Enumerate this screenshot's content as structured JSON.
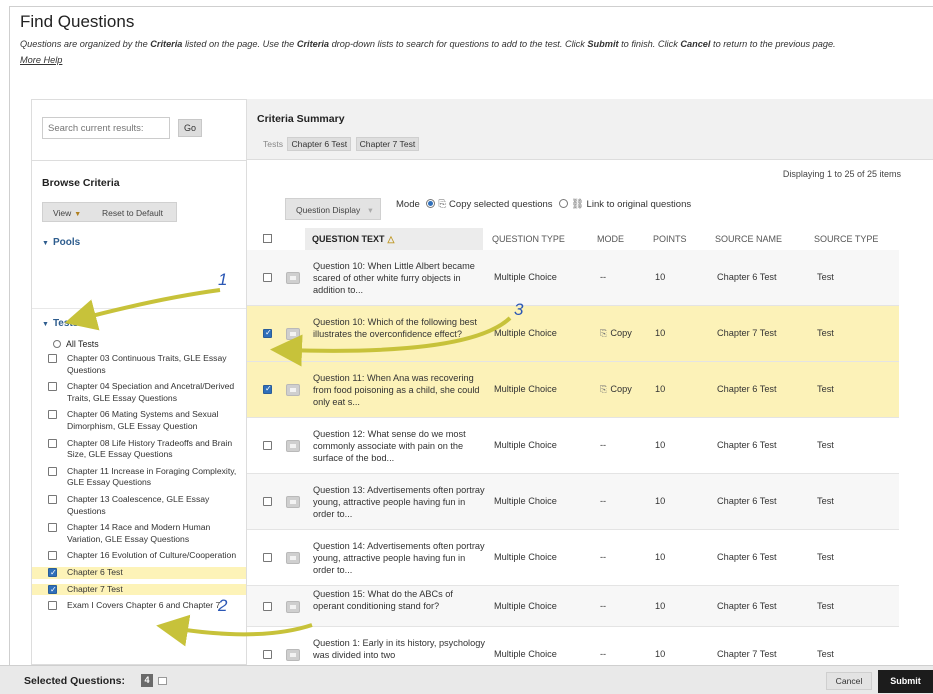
{
  "page": {
    "title": "Find Questions",
    "desc": {
      "p1": "Questions are organized by the ",
      "b1": "Criteria",
      "p2": " listed on the page. Use the ",
      "b2": "Criteria",
      "p3": " drop-down lists to search for questions to add to the test. Click ",
      "b3": "Submit",
      "p4": " to finish. Click ",
      "b4": "Cancel",
      "p5": " to return to the previous page."
    },
    "more_help": "More Help"
  },
  "left": {
    "search_placeholder": "Search current results:",
    "go_label": "Go",
    "browse_title": "Browse Criteria",
    "view_label": "View",
    "reset_label": "Reset to Default",
    "pools_label": "Pools",
    "tests_label": "Tests",
    "all_tests_label": "All Tests",
    "tests": [
      {
        "label": "Chapter 03 Continuous Traits, GLE Essay Questions",
        "checked": false
      },
      {
        "label": "Chapter 04 Speciation and Ancetral/Derived Traits, GLE Essay Questions",
        "checked": false
      },
      {
        "label": "Chapter 06 Mating Systems and Sexual Dimorphism, GLE Essay Question",
        "checked": false
      },
      {
        "label": "Chapter 08 Life History Tradeoffs and Brain Size, GLE Essay Questions",
        "checked": false
      },
      {
        "label": "Chapter 11 Increase in Foraging Complexity, GLE Essay Questions",
        "checked": false
      },
      {
        "label": "Chapter 13 Coalescence, GLE Essay Questions",
        "checked": false
      },
      {
        "label": "Chapter 14 Race and Modern Human Variation, GLE Essay Questions",
        "checked": false
      },
      {
        "label": "Chapter 16 Evolution of Culture/Cooperation",
        "checked": false
      },
      {
        "label": "Chapter 6 Test",
        "checked": true
      },
      {
        "label": "Chapter 7 Test",
        "checked": true
      },
      {
        "label": "Exam I Covers Chapter 6 and Chapter 7",
        "checked": false
      }
    ]
  },
  "criteria": {
    "title": "Criteria Summary",
    "tests_prefix": "Tests",
    "chips": [
      "Chapter 6 Test",
      "Chapter 7 Test"
    ],
    "displaying": "Displaying 1 to 25 of 25 items",
    "question_display_label": "Question Display",
    "mode_label": "Mode",
    "copy_option": "Copy selected questions",
    "link_option": "Link to original questions",
    "mode_selected": "copy"
  },
  "grid": {
    "headers": {
      "question_text": "QUESTION TEXT",
      "question_type": "QUESTION TYPE",
      "mode": "MODE",
      "points": "POINTS",
      "source_name": "SOURCE NAME",
      "source_type": "SOURCE TYPE"
    },
    "rows": [
      {
        "text": "Question 10:  When Little Albert became scared of other white furry objects in addition to...",
        "type": "Multiple Choice",
        "mode": "--",
        "points": "10",
        "source": "Chapter 6 Test",
        "stype": "Test",
        "selected": false
      },
      {
        "text": "Question 10:  Which of the following best illustrates the overconfidence effect?",
        "type": "Multiple Choice",
        "mode": "Copy",
        "points": "10",
        "source": "Chapter 7 Test",
        "stype": "Test",
        "selected": true
      },
      {
        "text": "Question 11:  When Ana was recovering from food poisoning as a child, she could only eat s...",
        "type": "Multiple Choice",
        "mode": "Copy",
        "points": "10",
        "source": "Chapter 6 Test",
        "stype": "Test",
        "selected": true
      },
      {
        "text": "Question 12:  What sense do we most commonly associate with pain on the surface of the bod...",
        "type": "Multiple Choice",
        "mode": "--",
        "points": "10",
        "source": "Chapter 6 Test",
        "stype": "Test",
        "selected": false
      },
      {
        "text": "Question 13:  Advertisements often portray young, attractive people having fun in order to...",
        "type": "Multiple Choice",
        "mode": "--",
        "points": "10",
        "source": "Chapter 6 Test",
        "stype": "Test",
        "selected": false
      },
      {
        "text": "Question 14:  Advertisements often portray young, attractive people having fun in order to...",
        "type": "Multiple Choice",
        "mode": "--",
        "points": "10",
        "source": "Chapter 6 Test",
        "stype": "Test",
        "selected": false
      },
      {
        "text": "Question 15:  What do the ABCs of operant conditioning stand for?",
        "type": "Multiple Choice",
        "mode": "--",
        "points": "10",
        "source": "Chapter 6 Test",
        "stype": "Test",
        "selected": false
      },
      {
        "text": "Question 1:  Early in its history, psychology was divided into two",
        "type": "Multiple Choice",
        "mode": "--",
        "points": "10",
        "source": "Chapter 7 Test",
        "stype": "Test",
        "selected": false
      }
    ]
  },
  "bottom": {
    "selected_label": "Selected Questions:",
    "selected_count": "4",
    "cancel_label": "Cancel",
    "submit_label": "Submit"
  },
  "annotations": [
    "1",
    "2",
    "3"
  ],
  "colors": {
    "accent_blue": "#2f6fba",
    "highlight": "#fcf2b8",
    "arrow": "#c7c23a",
    "annotation": "#2b57b5"
  }
}
